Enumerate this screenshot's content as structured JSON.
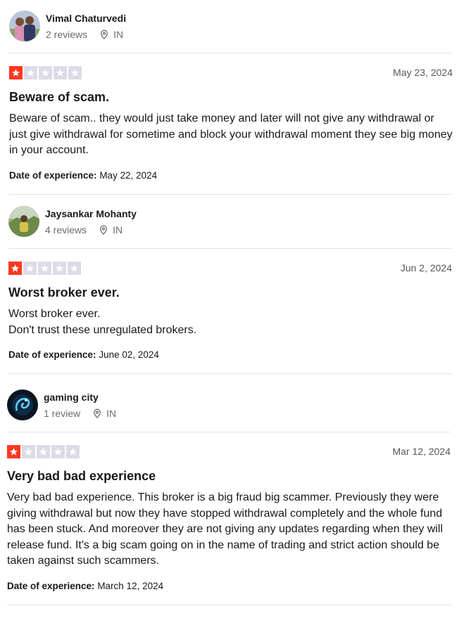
{
  "reviews": [
    {
      "reviewer": {
        "name": "Vimal Chaturvedi",
        "reviews_count": "2 reviews",
        "country": "IN"
      },
      "rating": 1,
      "date": "May 23, 2024",
      "title": "Beware of scam.",
      "body": "Beware of scam.. they would just take money and later will not give any withdrawal or just give withdrawal for sometime and block your withdrawal moment they see big money in your account.",
      "experience_label": "Date of experience:",
      "experience_date": "May 22, 2024"
    },
    {
      "reviewer": {
        "name": "Jaysankar Mohanty",
        "reviews_count": "4 reviews",
        "country": "IN"
      },
      "rating": 1,
      "date": "Jun 2, 2024",
      "title": "Worst broker ever.",
      "body": "Worst broker ever.\nDon't trust these unregulated brokers.",
      "experience_label": "Date of experience:",
      "experience_date": "June 02, 2024"
    },
    {
      "reviewer": {
        "name": "gaming city",
        "reviews_count": "1 review",
        "country": "IN"
      },
      "rating": 1,
      "date": "Mar 12, 2024",
      "title": "Very bad bad experience",
      "body": "Very bad bad experience. This broker is a big fraud big scammer. Previously they were giving withdrawal but now they have stopped withdrawal completely and the whole fund has been stuck. And moreover they are not giving any updates regarding when they will release fund. It's a big scam going on in the name of trading and strict action should be taken against such scammers.",
      "experience_label": "Date of experience:",
      "experience_date": "March 12, 2024"
    }
  ],
  "colors": {
    "star_filled": "#ff3722",
    "star_empty": "#dcdce6",
    "meta_text": "#6b6b6b"
  },
  "icons": {
    "location": "location-pin-icon",
    "star": "star-icon"
  }
}
